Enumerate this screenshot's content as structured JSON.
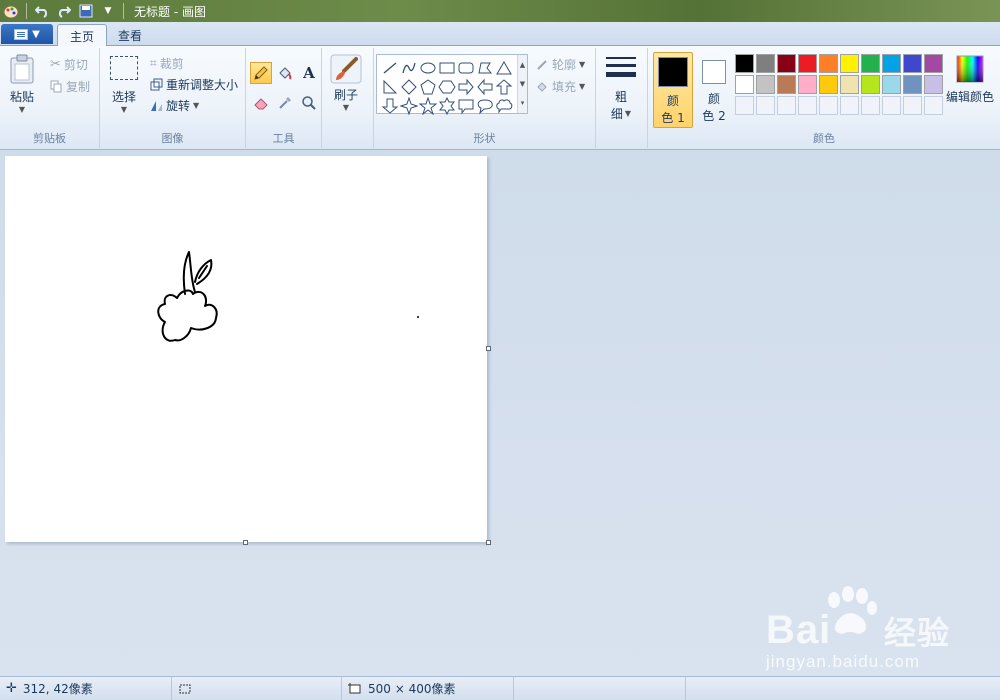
{
  "window": {
    "title": "无标题 - 画图"
  },
  "tabs": [
    {
      "label": "主页"
    },
    {
      "label": "查看"
    }
  ],
  "clipboard": {
    "paste": "粘贴",
    "cut": "剪切",
    "copy": "复制",
    "group": "剪贴板"
  },
  "image": {
    "select": "选择",
    "crop": "裁剪",
    "resize": "重新调整大小",
    "rotate": "旋转",
    "group": "图像"
  },
  "tools": {
    "group": "工具",
    "active": "pencil-icon"
  },
  "brush": {
    "label": "刷子"
  },
  "shapes": {
    "outline": "轮廓",
    "fill": "填充",
    "group": "形状"
  },
  "size": {
    "label_top": "粗",
    "label_bottom": "细"
  },
  "colors": {
    "color1_top": "颜",
    "color1_bottom": "色 1",
    "color2_top": "颜",
    "color2_bottom": "色 2",
    "edit": "编辑颜色",
    "group": "颜色",
    "color1": "#000000",
    "color2": "#ffffff",
    "palette_row1": [
      "#000000",
      "#7f7f7f",
      "#880015",
      "#ed1c24",
      "#ff7f27",
      "#fff200",
      "#22b14c",
      "#00a2e8",
      "#3f48cc",
      "#a349a4"
    ],
    "palette_row2": [
      "#ffffff",
      "#c3c3c3",
      "#b97a57",
      "#ffaec9",
      "#ffc90e",
      "#efe4b0",
      "#b5e61d",
      "#99d9ea",
      "#7092be",
      "#c8bfe7"
    ],
    "palette_row3": [
      "#f0f4fa",
      "#f0f4fa",
      "#f0f4fa",
      "#f0f4fa",
      "#f0f4fa",
      "#f0f4fa",
      "#f0f4fa",
      "#f0f4fa",
      "#f0f4fa",
      "#f0f4fa"
    ]
  },
  "status": {
    "cursor": "312, 42像素",
    "canvas_size": "500 × 400像素"
  },
  "watermark": {
    "brand": "Bai",
    "brand_cn": "经验",
    "url": "jingyan.baidu.com"
  }
}
